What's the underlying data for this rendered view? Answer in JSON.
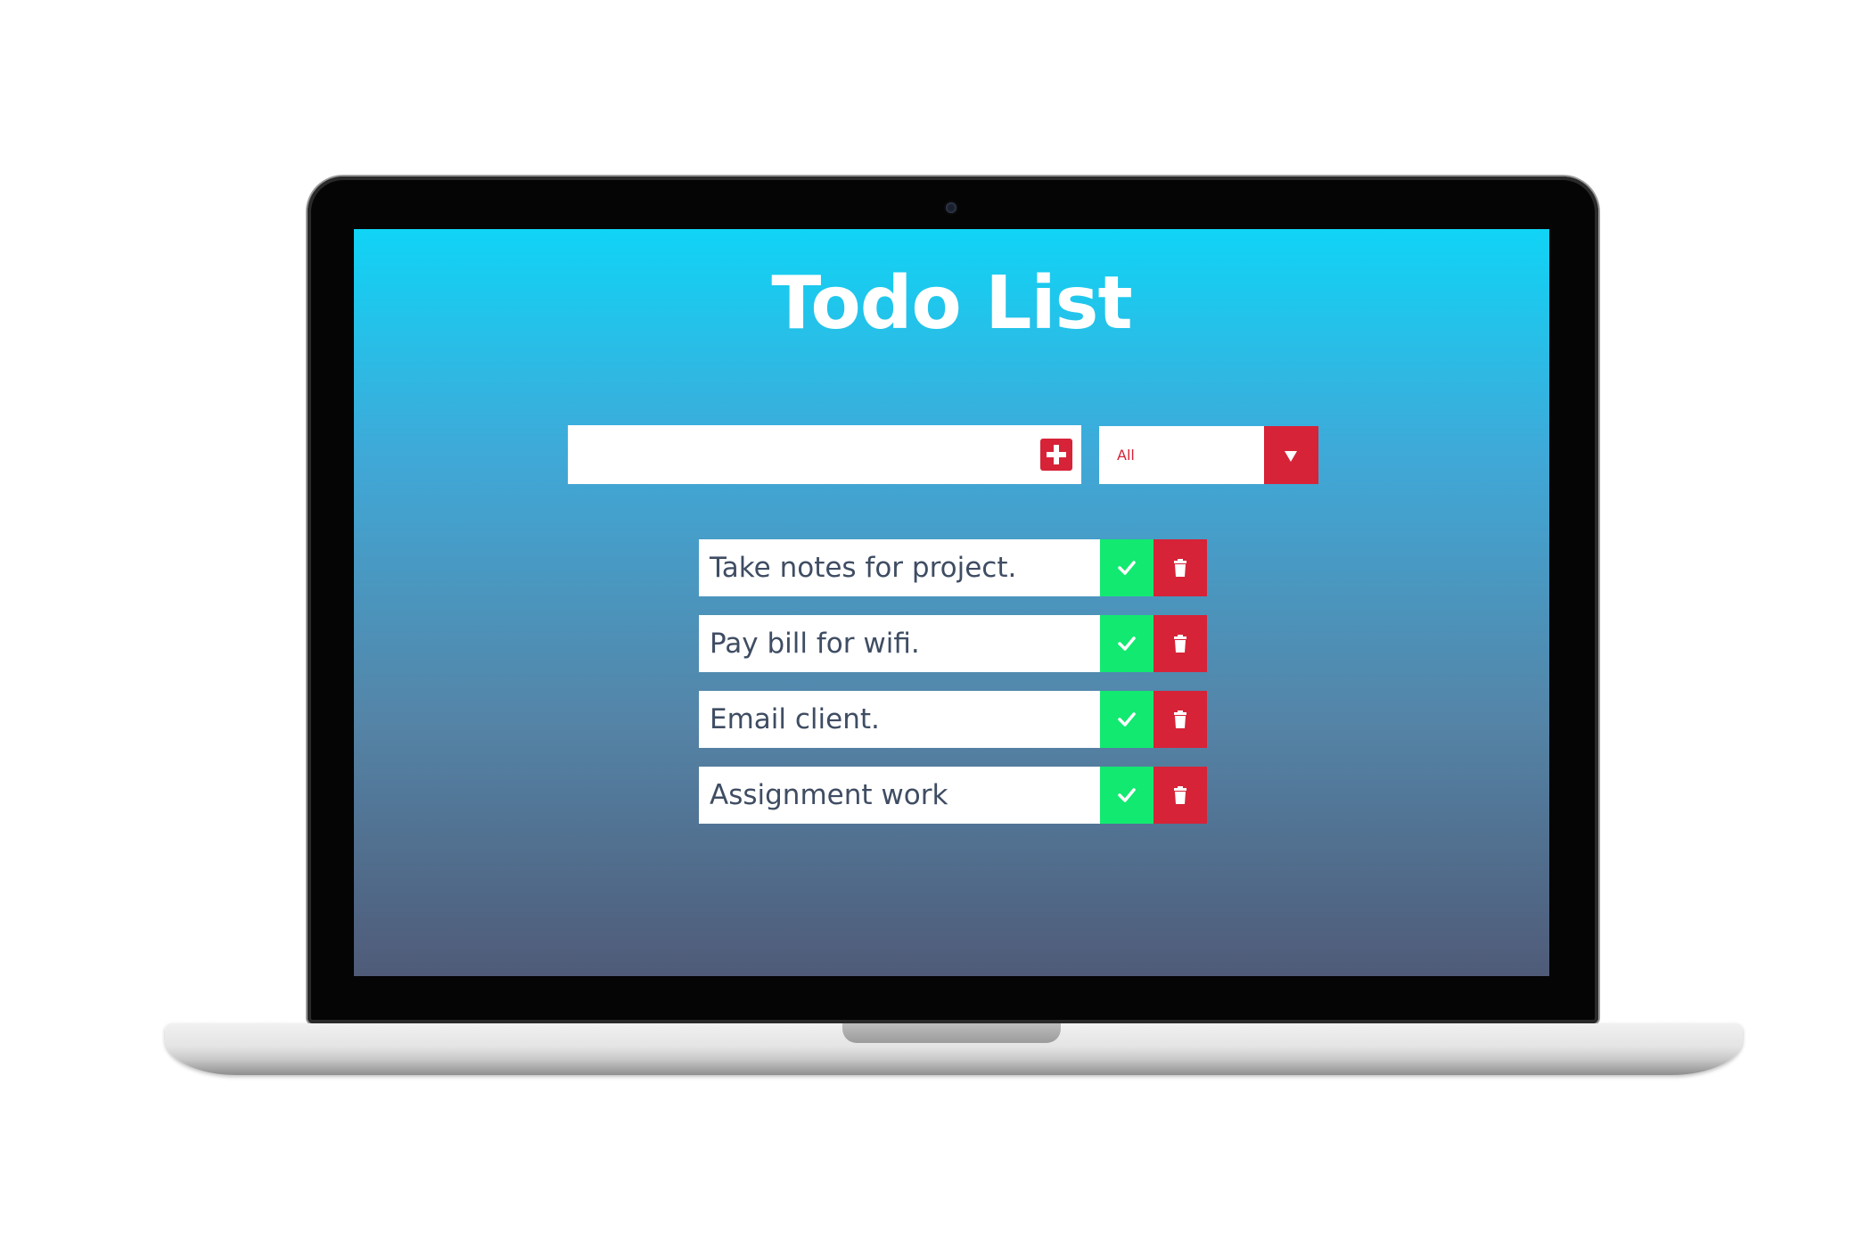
{
  "app": {
    "title": "Todo List"
  },
  "input": {
    "value": "",
    "placeholder": "",
    "add_icon": "plus-icon"
  },
  "filter": {
    "selected": "All",
    "arrow_icon": "caret-down-icon"
  },
  "todos": [
    {
      "text": "Take notes for project."
    },
    {
      "text": "Pay bill for wifi."
    },
    {
      "text": "Email client."
    },
    {
      "text": "Assignment work"
    }
  ],
  "item_actions": {
    "complete_icon": "check-icon",
    "delete_icon": "trash-icon"
  },
  "colors": {
    "accent_red": "#d62338",
    "complete_green": "#12e970",
    "gradient_top": "#10d4f6",
    "gradient_bottom": "#4f5b78",
    "text_dark": "#3f4d63"
  }
}
